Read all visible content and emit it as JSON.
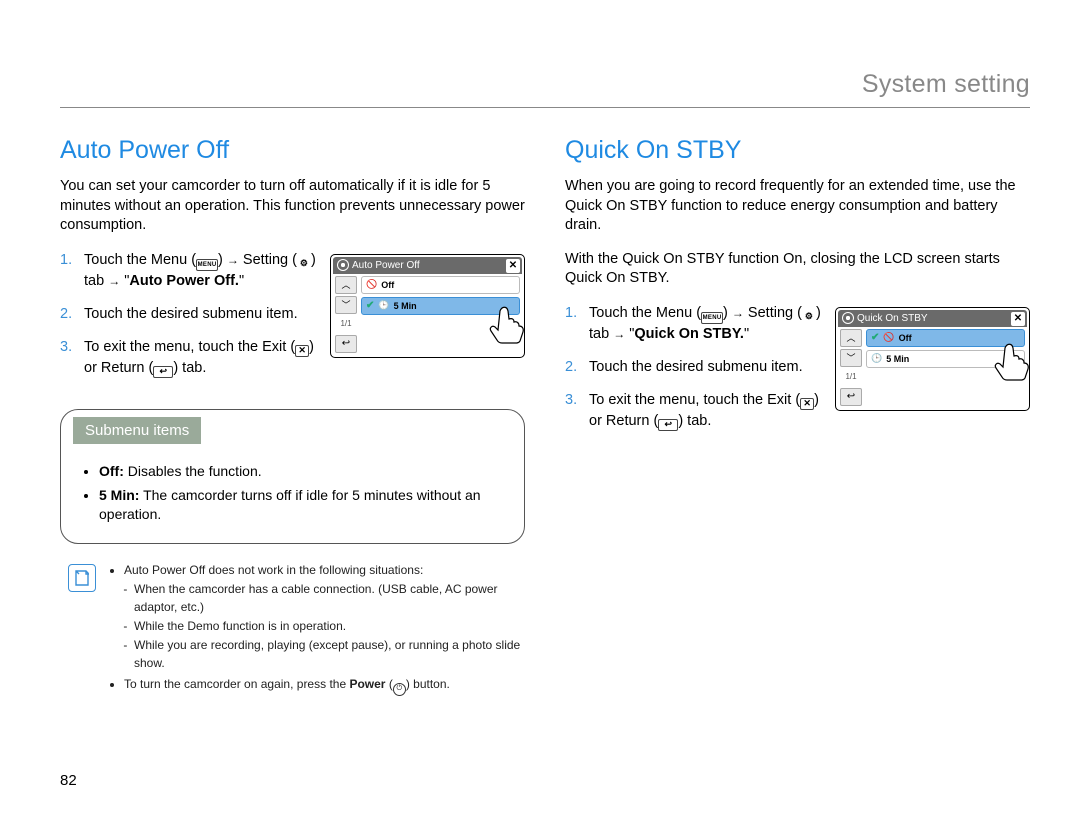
{
  "header": {
    "title": "System setting"
  },
  "page_number": "82",
  "left": {
    "heading": "Auto Power Off",
    "intro": "You can set your camcorder to turn off automatically if it is idle for 5 minutes without an operation. This function prevents unnecessary power consumption.",
    "steps": {
      "s1_a": "Touch the Menu (",
      "menu_label": "MENU",
      "s1_b": ") ",
      "arrow": "→",
      "s1_c": " Setting (",
      "s1_d": ") tab ",
      "s1_e": " \"",
      "s1_bold": "Auto Power Off.",
      "s1_f": "\"",
      "s2": "Touch the desired submenu item.",
      "s3_a": "To exit the menu, touch the Exit (",
      "s3_b": ") or Return (",
      "s3_c": ") tab."
    },
    "shot": {
      "title": "Auto Power Off",
      "row_off": "Off",
      "row_5": "5 Min",
      "page": "1/1"
    },
    "submenu": {
      "tab": "Submenu items",
      "off_label": "Off:",
      "off_text": " Disables the function.",
      "min_label": "5 Min:",
      "min_text": " The camcorder turns off if idle for 5 minutes without an operation."
    },
    "note": {
      "b1": "Auto Power Off does not work in the following situations:",
      "d1": "When the camcorder has a cable connection. (USB cable, AC power adaptor, etc.)",
      "d2": "While the Demo function is in operation.",
      "d3": "While you are recording, playing (except pause), or running a photo slide show.",
      "b2_a": "To turn the camcorder on again, press the ",
      "b2_bold": "Power",
      "b2_b": " (",
      "b2_c": ") button."
    }
  },
  "right": {
    "heading": "Quick On STBY",
    "intro1": "When you are going to record frequently for an extended time, use the Quick On STBY function to reduce energy consumption and battery drain.",
    "intro2": "With the Quick On STBY function On, closing the LCD screen starts Quick On STBY.",
    "steps": {
      "s1_a": "Touch the Menu (",
      "menu_label": "MENU",
      "s1_b": ") ",
      "arrow": "→",
      "s1_c": " Setting (",
      "s1_d": ") tab ",
      "s1_e": " \"",
      "s1_bold": "Quick On STBY.",
      "s1_f": "\"",
      "s2": "Touch the desired submenu item.",
      "s3_a": "To exit the menu, touch the Exit (",
      "s3_b": ") or Return (",
      "s3_c": ") tab."
    },
    "shot": {
      "title": "Quick On STBY",
      "row_off": "Off",
      "row_5": "5 Min",
      "page": "1/1"
    }
  }
}
